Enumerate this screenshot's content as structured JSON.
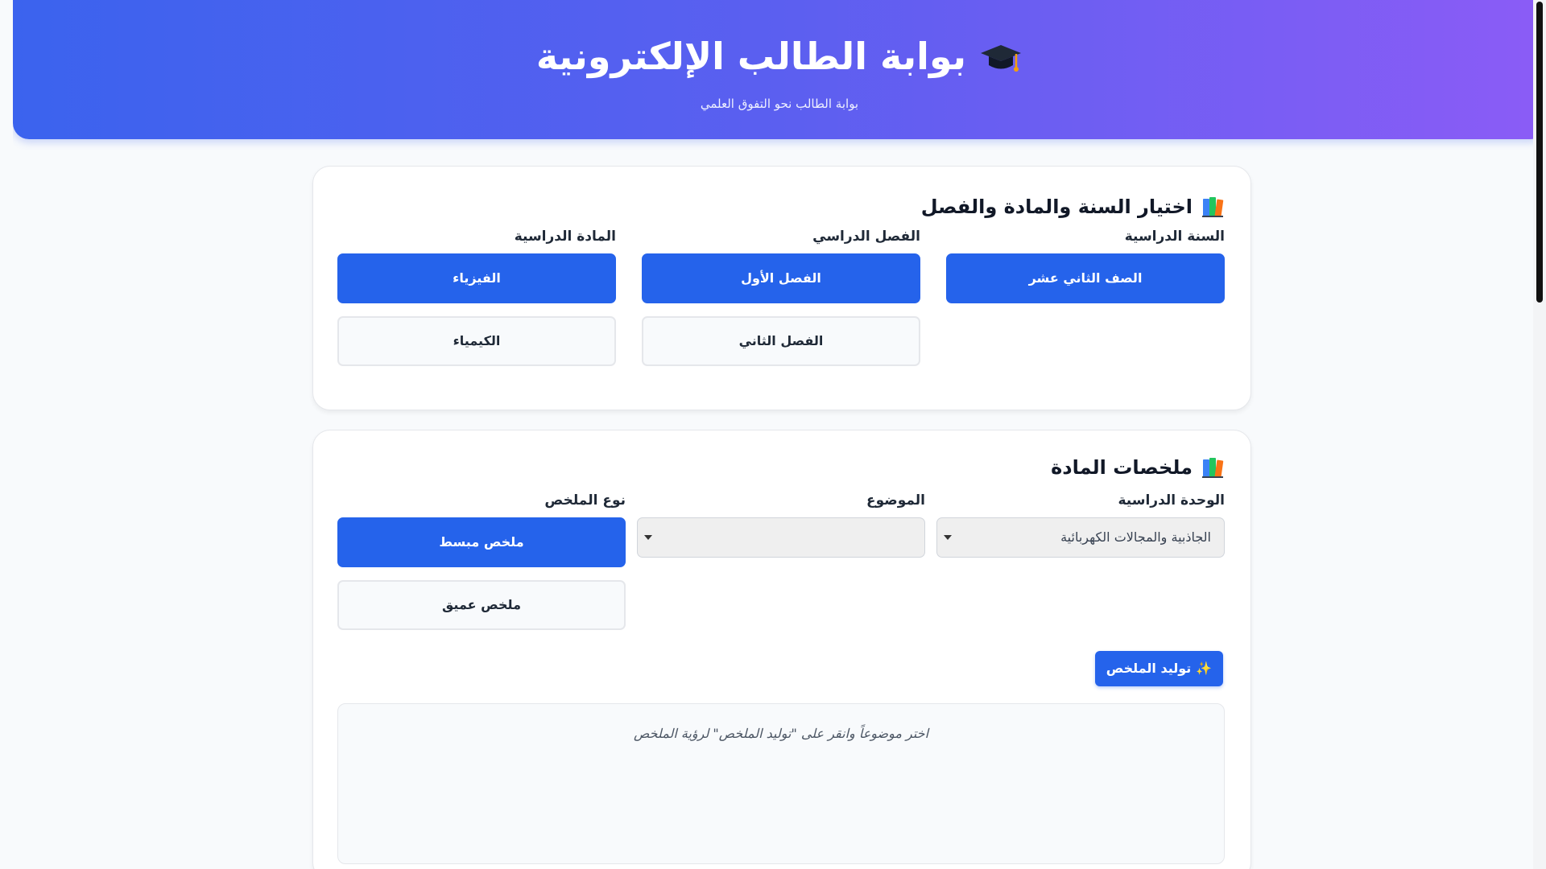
{
  "header": {
    "title": "بوابة الطالب الإلكترونية",
    "subtitle": "بوابة الطالب نحو التفوق العلمي",
    "icon": "graduation-cap-icon"
  },
  "selection": {
    "title": "اختيار السنة والمادة والفصل",
    "icon": "books-icon",
    "year": {
      "label": "السنة الدراسية",
      "options": [
        "الصف الثاني عشر"
      ],
      "selected": "الصف الثاني عشر"
    },
    "term": {
      "label": "الفصل الدراسي",
      "options": [
        "الفصل الأول",
        "الفصل الثاني"
      ],
      "selected": "الفصل الأول"
    },
    "subject": {
      "label": "المادة الدراسية",
      "options": [
        "الفيزياء",
        "الكيمياء"
      ],
      "selected": "الفيزياء"
    }
  },
  "summaries": {
    "title": "ملخصات المادة",
    "icon": "books-icon",
    "unit": {
      "label": "الوحدة الدراسية",
      "value": "الجاذبية والمجالات الكهربائية"
    },
    "topic": {
      "label": "الموضوع",
      "value": ""
    },
    "type": {
      "label": "نوع الملخص",
      "options": [
        "ملخص مبسط",
        "ملخص عميق"
      ],
      "selected": "ملخص مبسط"
    },
    "generate_label": "توليد الملخص",
    "generate_icon": "sparkles-icon",
    "placeholder": "اختر موضوعاً وانقر على \"توليد الملخص\" لرؤية الملخص"
  },
  "colors": {
    "primary": "#2563eb",
    "header_start": "#3b63ee",
    "header_end": "#8b5cf6"
  }
}
